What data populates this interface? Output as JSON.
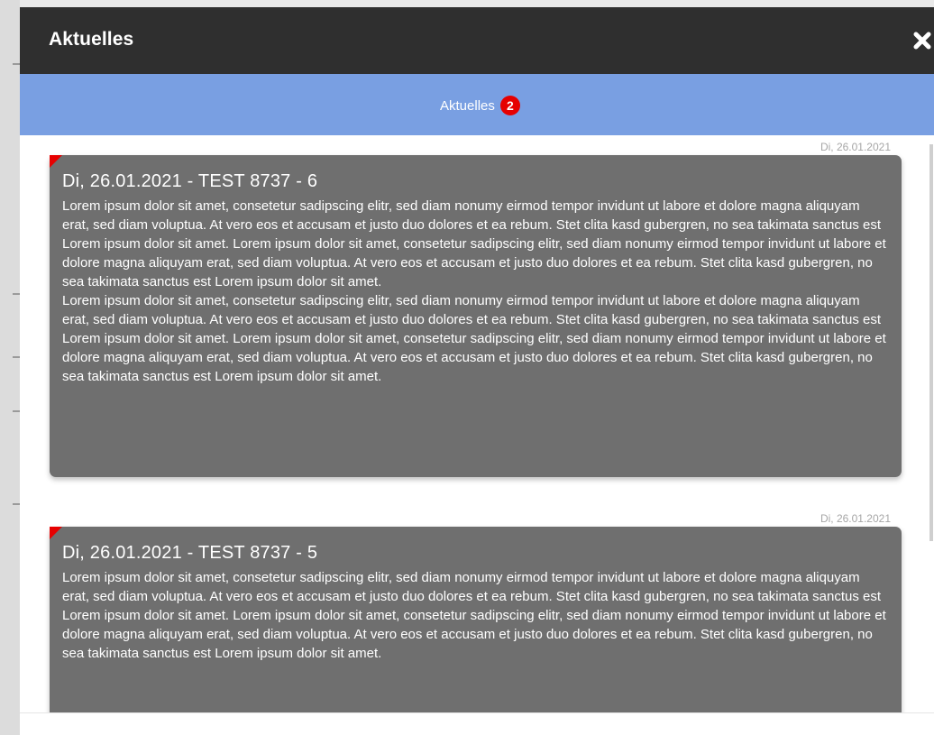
{
  "modal": {
    "title": "Aktuelles",
    "close_icon": "close-icon"
  },
  "tabs": [
    {
      "label": "Aktuelles",
      "badge": "2"
    }
  ],
  "posts": [
    {
      "date": "Di,  26.01.2021",
      "title": "Di,   26.01.2021 - TEST 8737 - 6",
      "paragraphs": [
        "Lorem ipsum dolor sit amet, consetetur sadipscing elitr, sed diam nonumy eirmod tempor invidunt ut labore et dolore magna aliquyam erat, sed diam voluptua. At vero eos et accusam et justo duo dolores et ea rebum. Stet clita kasd gubergren, no sea takimata sanctus est Lorem ipsum dolor sit amet. Lorem ipsum dolor sit amet, consetetur sadipscing elitr, sed diam nonumy eirmod tempor invidunt ut labore et dolore magna aliquyam erat, sed diam voluptua. At vero eos et accusam et justo duo dolores et ea rebum. Stet clita kasd gubergren, no sea takimata sanctus est Lorem ipsum dolor sit amet.",
        "Lorem ipsum dolor sit amet, consetetur sadipscing elitr, sed diam nonumy eirmod tempor invidunt ut labore et dolore magna aliquyam erat, sed diam voluptua. At vero eos et accusam et justo duo dolores et ea rebum. Stet clita kasd gubergren, no sea takimata sanctus est Lorem ipsum dolor sit amet. Lorem ipsum dolor sit amet, consetetur sadipscing elitr, sed diam nonumy eirmod tempor invidunt ut labore et dolore magna aliquyam erat, sed diam voluptua. At vero eos et accusam et justo duo dolores et ea rebum. Stet clita kasd gubergren, no sea takimata sanctus est Lorem ipsum dolor sit amet."
      ]
    },
    {
      "date": "Di,  26.01.2021",
      "title": "Di,   26.01.2021 - TEST 8737 - 5",
      "paragraphs": [
        "Lorem ipsum dolor sit amet, consetetur sadipscing elitr, sed diam nonumy eirmod tempor invidunt ut labore et dolore magna aliquyam erat, sed diam voluptua. At vero eos et accusam et justo duo dolores et ea rebum. Stet clita kasd gubergren, no sea takimata sanctus est Lorem ipsum dolor sit amet. Lorem ipsum dolor sit amet, consetetur sadipscing elitr, sed diam nonumy eirmod tempor invidunt ut labore et dolore magna aliquyam erat, sed diam voluptua. At vero eos et accusam et justo duo dolores et ea rebum. Stet clita kasd gubergren, no sea takimata sanctus est Lorem ipsum dolor sit amet."
      ]
    }
  ],
  "colors": {
    "header": "#2f2f2f",
    "tab_bar": "#799fe2",
    "badge": "#e60000",
    "card": "#6f6f6f",
    "corner": "#e60000"
  }
}
